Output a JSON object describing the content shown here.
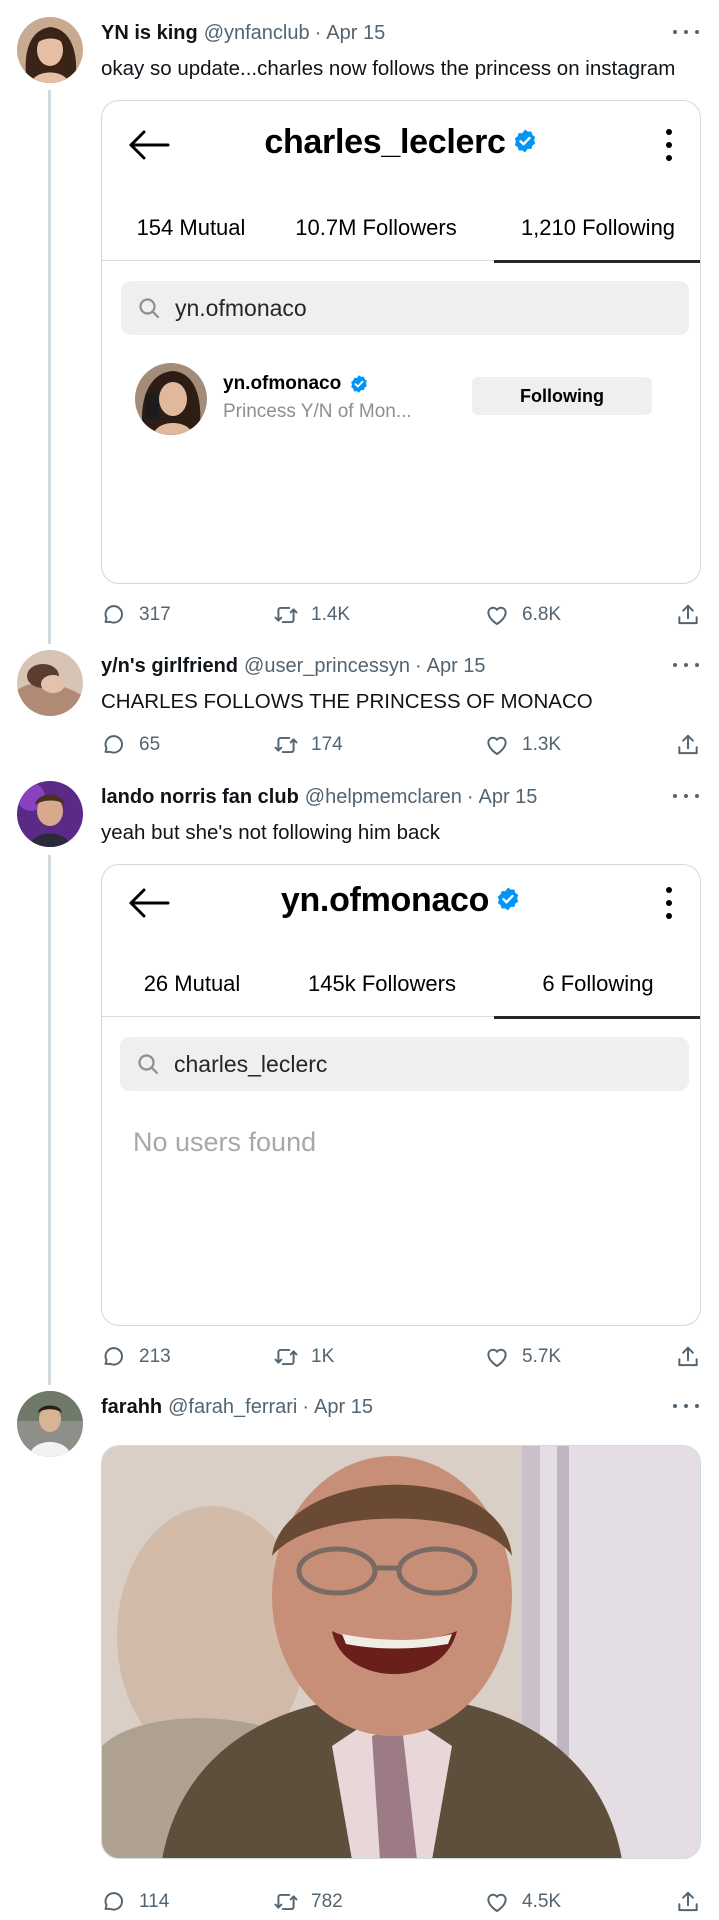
{
  "colors": {
    "verified_blue": "#0095f6",
    "twitter_gray": "#536471",
    "thread_line": "#cfd9de"
  },
  "tweets": [
    {
      "name": "YN is king",
      "handle": "@ynfanclub",
      "date": "Apr 15",
      "text": "okay so update...charles now follows the princess on instagram",
      "card": {
        "title": "charles_leclerc",
        "tabs": [
          "154 Mutual",
          "10.7M Followers",
          "1,210 Following"
        ],
        "active_tab": 2,
        "search": "yn.ofmonaco",
        "user": {
          "username": "yn.ofmonaco",
          "subtitle": "Princess Y/N of Mon...",
          "button": "Following"
        }
      },
      "replies": "317",
      "retweets": "1.4K",
      "likes": "6.8K"
    },
    {
      "name": "y/n's girlfriend",
      "handle": "@user_princessyn",
      "date": "Apr 15",
      "text": "CHARLES FOLLOWS THE PRINCESS OF MONACO",
      "replies": "65",
      "retweets": "174",
      "likes": "1.3K"
    },
    {
      "name": "lando norris fan club",
      "handle": "@helpmemclaren",
      "date": "Apr 15",
      "text": "yeah but she's not following him back",
      "card": {
        "title": "yn.ofmonaco",
        "tabs": [
          "26 Mutual",
          "145k Followers",
          "6 Following"
        ],
        "active_tab": 2,
        "search": "charles_leclerc",
        "empty": "No users found"
      },
      "replies": "213",
      "retweets": "1K",
      "likes": "5.7K"
    },
    {
      "name": "farahh",
      "handle": "@farah_ferrari",
      "date": "Apr 15",
      "media": "laughing-man-meme-image",
      "replies": "114",
      "retweets": "782",
      "likes": "4.5K"
    }
  ]
}
